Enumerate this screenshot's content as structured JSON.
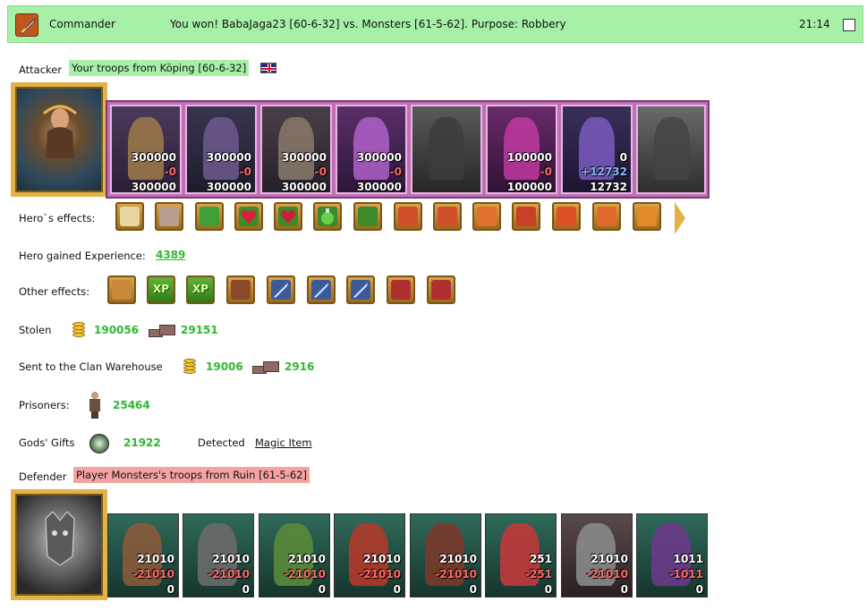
{
  "header": {
    "title": "Commander",
    "message": "You won! BabaJaga23 [60-6-32] vs. Monsters [61-5-62]. Purpose: Robbery",
    "time": "21:14"
  },
  "attacker": {
    "label": "Attacker",
    "troops_from": "Your troops from Köping [60-6-32]",
    "units": [
      {
        "count": "300000",
        "loss": "-0",
        "remaining": "300000"
      },
      {
        "count": "300000",
        "loss": "-0",
        "remaining": "300000"
      },
      {
        "count": "300000",
        "loss": "-0",
        "remaining": "300000"
      },
      {
        "count": "300000",
        "loss": "-0",
        "remaining": "300000"
      },
      {
        "count": "",
        "loss": "",
        "remaining": ""
      },
      {
        "count": "100000",
        "loss": "-0",
        "remaining": "100000"
      },
      {
        "count": "0",
        "loss": "+12732",
        "remaining": "12732"
      },
      {
        "count": "",
        "loss": "",
        "remaining": ""
      }
    ]
  },
  "hero_effects": {
    "label": "Hero`s effects:"
  },
  "hero_experience": {
    "label": "Hero gained Experience:",
    "value": "4389"
  },
  "other_effects": {
    "label": "Other effects:",
    "xp_text": "XP"
  },
  "stolen": {
    "label": "Stolen",
    "gold": "190056",
    "ore": "29151"
  },
  "clan_warehouse": {
    "label": "Sent to the Clan Warehouse",
    "gold": "19006",
    "ore": "2916"
  },
  "prisoners": {
    "label": "Prisoners:",
    "value": "25464"
  },
  "gods_gifts": {
    "label": "Gods' Gifts",
    "value": "21922",
    "detected_label": "Detected",
    "detected_item": "Magic Item"
  },
  "defender": {
    "label": "Defender",
    "troops_from": "Player Monsters's troops from Ruin [61-5-62]",
    "units": [
      {
        "count": "21010",
        "loss": "-21010",
        "remaining": "0"
      },
      {
        "count": "21010",
        "loss": "-21010",
        "remaining": "0"
      },
      {
        "count": "21010",
        "loss": "-21010",
        "remaining": "0"
      },
      {
        "count": "21010",
        "loss": "-21010",
        "remaining": "0"
      },
      {
        "count": "21010",
        "loss": "-21010",
        "remaining": "0"
      },
      {
        "count": "251",
        "loss": "-251",
        "remaining": "0"
      },
      {
        "count": "21010",
        "loss": "-21010",
        "remaining": "0"
      },
      {
        "count": "1011",
        "loss": "-1011",
        "remaining": "0"
      }
    ]
  },
  "colors": {
    "header_bg": "#a7f0a7",
    "attacker_tag": "#a7f0a7",
    "defender_tag": "#f4a3a3",
    "value_green": "#2fb82f",
    "loss_red": "#ff6b6b"
  }
}
